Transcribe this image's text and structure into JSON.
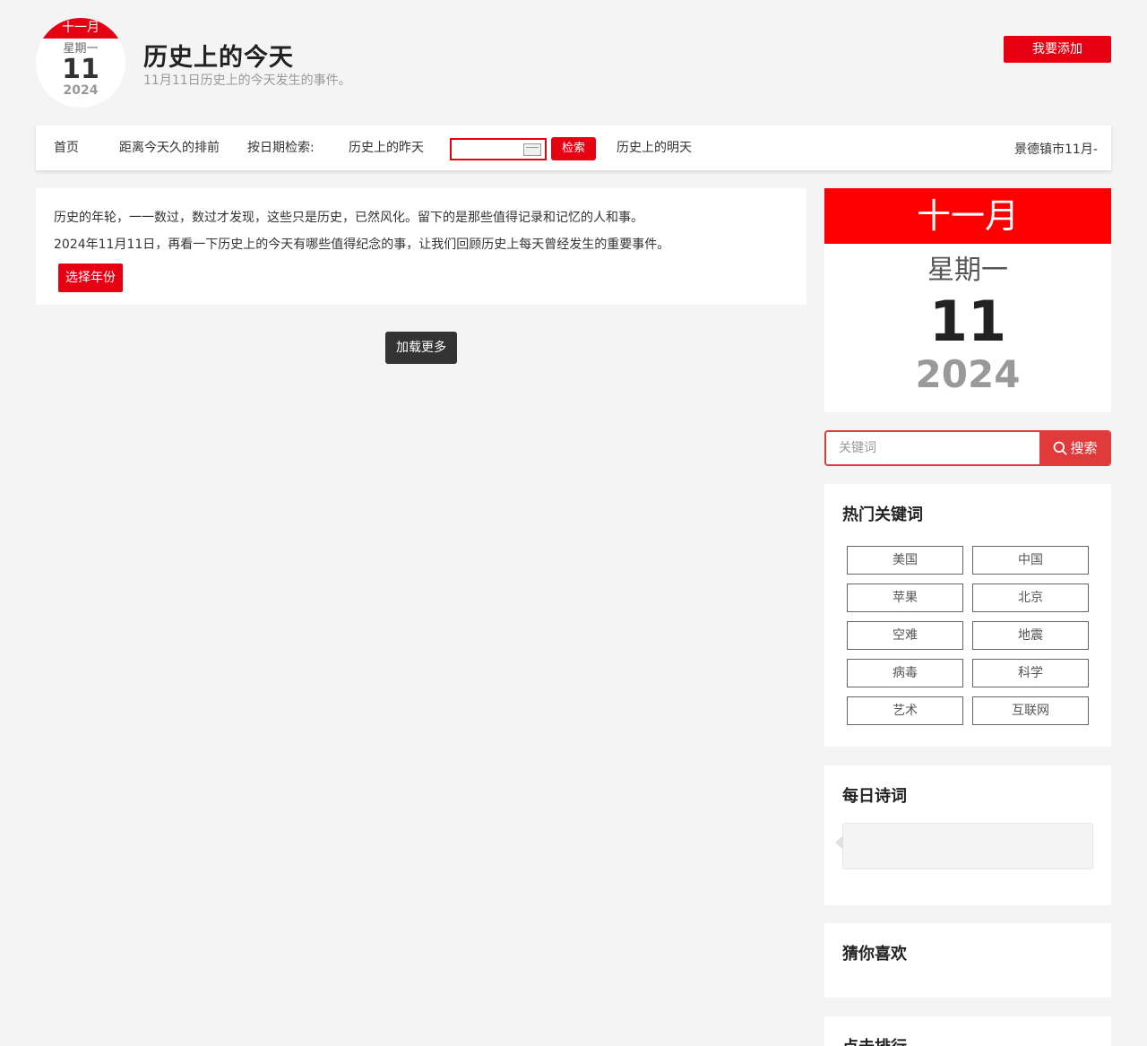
{
  "header": {
    "logo": {
      "month": "十一月",
      "weekday": "星期一",
      "day": "11",
      "year": "2024"
    },
    "title": "历史上的今天",
    "subtitle": "11月11日历史上的今天发生的事件。",
    "add_button": "我要添加"
  },
  "nav": {
    "home": "首页",
    "ranking": "距离今天久的排前",
    "date_search_label": "按日期检索:",
    "yesterday": "历史上的昨天",
    "search_button": "检索",
    "tomorrow": "历史上的明天",
    "ticker": "景德镇市11月-"
  },
  "intro": {
    "line1": "历史的年轮，一一数过，数过才发现，这些只是历史，已然风化。留下的是那些值得记录和记忆的人和事。",
    "line2": "2024年11月11日，再看一下历史上的今天有哪些值得纪念的事，让我们回顾历史上每天曾经发生的重要事件。",
    "year_button": "选择年份"
  },
  "load_more": "加载更多",
  "calendar": {
    "month": "十一月",
    "weekday": "星期一",
    "day": "11",
    "year": "2024"
  },
  "search": {
    "placeholder": "关键词",
    "button": "搜索"
  },
  "hot_keywords": {
    "title": "热门关键词",
    "tags": [
      "美国",
      "中国",
      "苹果",
      "北京",
      "空难",
      "地震",
      "病毒",
      "科学",
      "艺术",
      "互联网"
    ]
  },
  "daily_poem": {
    "title": "每日诗词"
  },
  "guess_like": {
    "title": "猜你喜欢"
  },
  "click_rank": {
    "title": "点击排行"
  },
  "colors": {
    "accent": "#e60012",
    "search_accent": "#e03a3a",
    "dark_button": "#333333",
    "background": "#f4f4f4"
  }
}
